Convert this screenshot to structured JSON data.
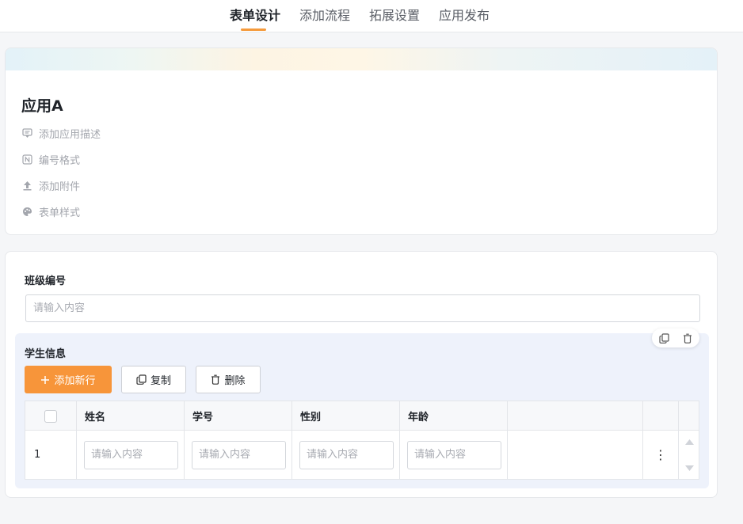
{
  "nav": {
    "tabs": [
      {
        "label": "表单设计",
        "active": true
      },
      {
        "label": "添加流程",
        "active": false
      },
      {
        "label": "拓展设置",
        "active": false
      },
      {
        "label": "应用发布",
        "active": false
      }
    ],
    "accent_color": "#f59a3b"
  },
  "app": {
    "title": "应用A",
    "options": [
      {
        "label": "添加应用描述",
        "icon": "message-icon"
      },
      {
        "label": "编号格式",
        "icon": "n-box-icon"
      },
      {
        "label": "添加附件",
        "icon": "upload-icon"
      },
      {
        "label": "表单样式",
        "icon": "palette-icon"
      }
    ]
  },
  "form": {
    "field_label": "班级编号",
    "field_placeholder": "请输入内容",
    "subform": {
      "title": "学生信息",
      "buttons": {
        "add_row": "添加新行",
        "copy": "复制",
        "delete": "删除"
      },
      "columns": [
        "姓名",
        "学号",
        "性别",
        "年龄"
      ],
      "rows": [
        {
          "index": "1",
          "placeholders": [
            "请输入内容",
            "请输入内容",
            "请输入内容",
            "请输入内容"
          ]
        }
      ],
      "more_symbol": "⋮"
    }
  },
  "colors": {
    "primary": "#f7953a",
    "subform_bg": "#eef2fb"
  }
}
